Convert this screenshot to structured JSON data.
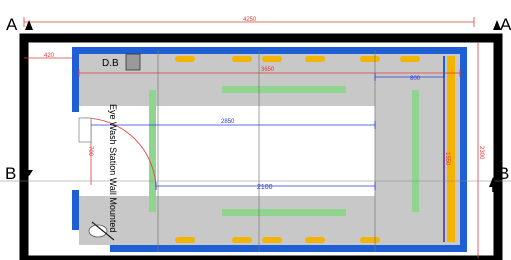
{
  "plan": {
    "section_marks": {
      "top_left": "A",
      "top_right": "A",
      "mid_left": "B",
      "mid_right": "B"
    },
    "dimensions": {
      "overall_width": "4250",
      "left_offset": "420",
      "inner_length": "3650",
      "right_segment": "800",
      "center_span": "2850",
      "bottom_span": "2100",
      "right_height": "1550",
      "overall_height": "2300",
      "door_width": "700"
    },
    "labels": {
      "distribution_board": "D.B",
      "eye_wash": "Eye Wash Station Wall Mounted"
    },
    "colors": {
      "outer_wall": "#000000",
      "inner_wall": "#1f5fd6",
      "floor": "#c8c8c8",
      "fixture": "#f2b400",
      "light": "#8fd48f",
      "dimension_red": "#e03a3a",
      "dimension_blue": "#2a3bd6"
    }
  }
}
